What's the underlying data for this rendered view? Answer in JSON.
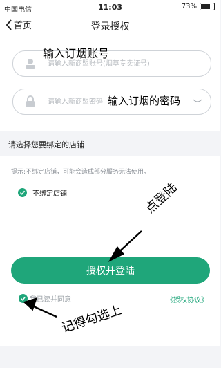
{
  "status_bar": {
    "carrier": "中国电信",
    "time": "11:03",
    "battery": "73%"
  },
  "nav": {
    "back_label": "首页",
    "title": "登录授权"
  },
  "account_field": {
    "placeholder": "请输入新商盟账号(烟草专卖证号)"
  },
  "password_field": {
    "placeholder": "请输入新商盟密码"
  },
  "store_section": {
    "title": "请选择您要绑定的店铺",
    "hint": "提示:不绑定店铺，可能会造成部分服务无法使用。",
    "no_bind_label": "不绑定店铺"
  },
  "login_button": {
    "label": "授权并登陆"
  },
  "agreement": {
    "label": "我已读并同意",
    "link_label": "《授权协议》"
  },
  "annotations": {
    "account": "输入订烟账号",
    "password": "输入订烟的密码",
    "tap_login": "点登陆",
    "remember_check": "记得勾选上"
  },
  "colors": {
    "accent": "#1fa67a",
    "background": "#f3f4f7"
  }
}
